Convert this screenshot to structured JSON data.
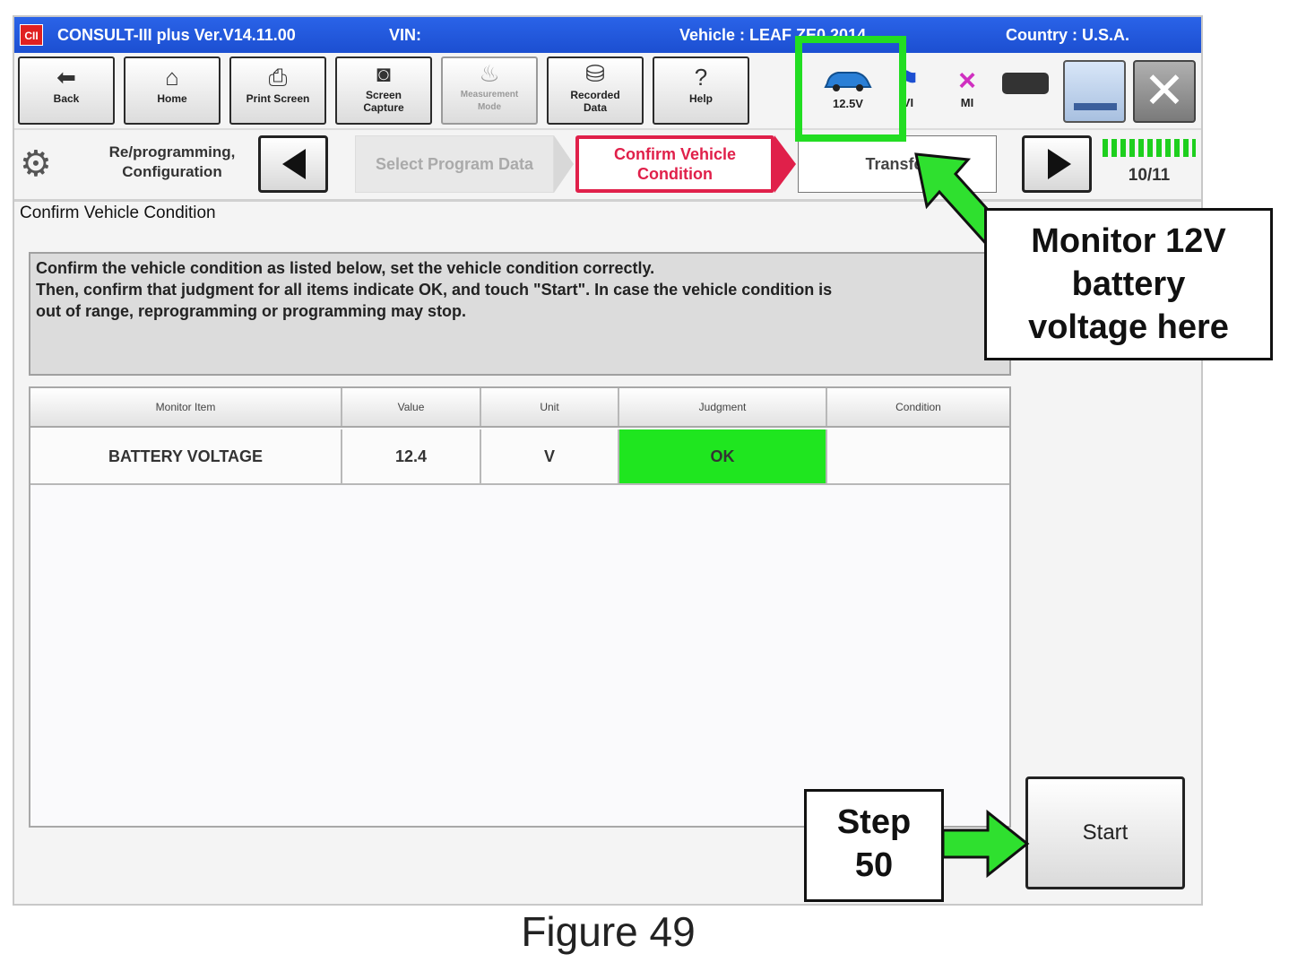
{
  "titlebar": {
    "logo": "CII",
    "app": "CONSULT-III plus  Ver.V14.11.00",
    "vin": "VIN:",
    "vehicle": "Vehicle : LEAF ZE0 2014",
    "country": "Country : U.S.A."
  },
  "toolbar": {
    "back": "Back",
    "home": "Home",
    "print": "Print Screen",
    "screen_capture_1": "Screen",
    "screen_capture_2": "Capture",
    "measurement_1": "Measurement",
    "measurement_2": "Mode",
    "recorded_1": "Recorded",
    "recorded_2": "Data",
    "help": "Help",
    "battery_voltage": "12.5V",
    "vi_label": "VI",
    "mi_label": "MI"
  },
  "navbar": {
    "section_1": "Re/programming,",
    "section_2": "Configuration",
    "step_prev": "Select Program Data",
    "step_current_1": "Confirm Vehicle",
    "step_current_2": "Condition",
    "step_next": "Transfer",
    "progress": "10/11"
  },
  "main": {
    "title": "Confirm Vehicle Condition",
    "message_1": "Confirm the vehicle condition as listed below, set the vehicle condition correctly.",
    "message_2": "Then, confirm that judgment for all items indicate OK, and touch \"Start\". In case the vehicle condition is",
    "message_3": "out of range, reprogramming or programming may stop.",
    "columns": [
      "Monitor Item",
      "Value",
      "Unit",
      "Judgment",
      "Condition"
    ],
    "rows": [
      {
        "item": "BATTERY VOLTAGE",
        "value": "12.4",
        "unit": "V",
        "judgment": "OK",
        "condition": ""
      }
    ],
    "start_label": "Start"
  },
  "annotations": {
    "monitor_1": "Monitor 12V",
    "monitor_2": "battery",
    "monitor_3": "voltage here",
    "step_1": "Step",
    "step_2": "50",
    "figure": "Figure 49"
  },
  "colors": {
    "title_bar": "#1c4fd1",
    "ok_green": "#1fe61f",
    "highlight_green": "#22dd22",
    "current_step_red": "#e0204a"
  }
}
